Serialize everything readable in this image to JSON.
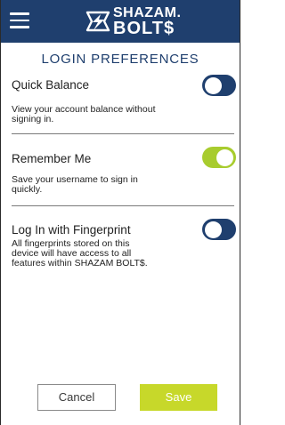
{
  "header": {
    "logo_line1": "SHAZAM.",
    "logo_line2": "BOLT$",
    "colors": {
      "bar": "#1f3f6e",
      "accent_green": "#a8cc2e"
    }
  },
  "page": {
    "title": "LOGIN PREFERENCES"
  },
  "preferences": [
    {
      "label": "Quick Balance",
      "description": "View your account balance without signing in.",
      "enabled": false
    },
    {
      "label": "Remember Me",
      "description": "Save your username to sign in quickly.",
      "enabled": true
    },
    {
      "label": "Log In with Fingerprint",
      "description": "All fingerprints stored on this device will have access to all features within SHAZAM BOLT$.",
      "enabled": false
    }
  ],
  "actions": {
    "cancel_label": "Cancel",
    "save_label": "Save"
  },
  "icons": [
    "menu-icon",
    "shazam-bolt-logo-icon"
  ]
}
